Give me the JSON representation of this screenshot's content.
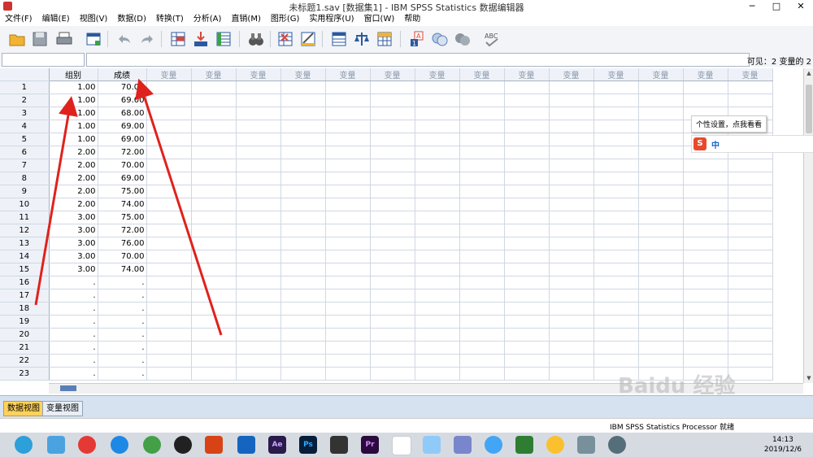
{
  "window": {
    "title": "未标题1.sav [数据集1] - IBM SPSS Statistics 数据编辑器"
  },
  "menu": [
    "文件(F)",
    "编辑(E)",
    "视图(V)",
    "数据(D)",
    "转换(T)",
    "分析(A)",
    "直销(M)",
    "图形(G)",
    "实用程序(U)",
    "窗口(W)",
    "帮助"
  ],
  "cellbar": {
    "cell_ref": "",
    "cell_value": "",
    "visible_text": "可见：2 变量的 2"
  },
  "grid": {
    "named_columns": [
      "组别",
      "成绩"
    ],
    "empty_column_label": "变量",
    "rows": [
      {
        "num": "1",
        "group": "1.00",
        "score": "70.00"
      },
      {
        "num": "2",
        "group": "1.00",
        "score": "69.00"
      },
      {
        "num": "3",
        "group": "1.00",
        "score": "68.00"
      },
      {
        "num": "4",
        "group": "1.00",
        "score": "69.00"
      },
      {
        "num": "5",
        "group": "1.00",
        "score": "69.00"
      },
      {
        "num": "6",
        "group": "2.00",
        "score": "72.00"
      },
      {
        "num": "7",
        "group": "2.00",
        "score": "70.00"
      },
      {
        "num": "8",
        "group": "2.00",
        "score": "69.00"
      },
      {
        "num": "9",
        "group": "2.00",
        "score": "75.00"
      },
      {
        "num": "10",
        "group": "2.00",
        "score": "74.00"
      },
      {
        "num": "11",
        "group": "3.00",
        "score": "75.00"
      },
      {
        "num": "12",
        "group": "3.00",
        "score": "72.00"
      },
      {
        "num": "13",
        "group": "3.00",
        "score": "76.00"
      },
      {
        "num": "14",
        "group": "3.00",
        "score": "70.00"
      },
      {
        "num": "15",
        "group": "3.00",
        "score": "74.00"
      },
      {
        "num": "16",
        "group": ".",
        "score": "."
      },
      {
        "num": "17",
        "group": ".",
        "score": "."
      },
      {
        "num": "18",
        "group": ".",
        "score": "."
      },
      {
        "num": "19",
        "group": ".",
        "score": "."
      },
      {
        "num": "20",
        "group": ".",
        "score": "."
      },
      {
        "num": "21",
        "group": ".",
        "score": "."
      },
      {
        "num": "22",
        "group": ".",
        "score": "."
      },
      {
        "num": "23",
        "group": ".",
        "score": "."
      }
    ]
  },
  "sheet_tabs": {
    "data_view": "数据视图",
    "variable_view": "变量视图"
  },
  "status": {
    "processor": "IBM SPSS Statistics Processor 就绪"
  },
  "ime": {
    "tip": "个性设置，点我看看",
    "mode": "中"
  },
  "taskbar": {
    "time": "14:13",
    "date": "2019/12/6",
    "apps": [
      "Ae",
      "Ps",
      "Pr"
    ]
  },
  "colors": {
    "active_tab": "#ffd25c",
    "arrow": "#e0221c",
    "header_bg": "#eef2f8"
  },
  "watermark": "Baidu 经验"
}
